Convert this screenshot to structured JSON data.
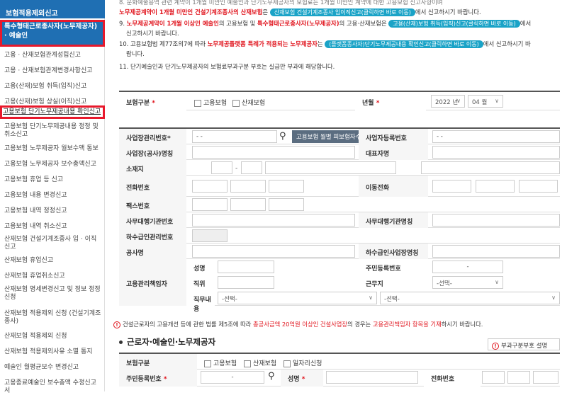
{
  "sidebar": {
    "header": "보험적용제외신고",
    "active": "특수형태근로종사자(노무제공자) · 예술인",
    "items": [
      "고용 · 산재보험관계성립신고",
      "고용 · 산재보험관계변경사항신고",
      "고용(산재)보험 취득(입직)신고",
      "고용(산재)보험 상실(이직)신고",
      "고용보험 단기노무제공내용 확인신고",
      "고용보험 단기노무제공내용 정정 및 취소신고",
      "고용보험 노무제공자 월보수액 통보",
      "고용보험 노무제공자 보수총액신고",
      "고용보험 휴업 등 신고",
      "고용보험 내용 변경신고",
      "고용보험 내역 정정신고",
      "고용보험 내역 취소신고",
      "산재보험 건설기계조종사 입 · 이직신고",
      "산재보험 휴업신고",
      "산재보험 휴업취소신고",
      "산재보험 명세변경신고 및 정보 정정신청",
      "산재보험 적용제외 신청 (건설기계조종사)",
      "산재보험 적용제외 신청",
      "산재보험 적용제외사유 소멸 통지",
      "예술인 월평균보수 변경신고",
      "고용종료예술인 보수총액 수정신고서"
    ]
  },
  "notes": {
    "n8a": "8. 노무제공계약이 1개월 미만인 ",
    "n8_top": "8. 문화예술용역 관련 계약이 1개월 미만인 예술인과 단기노무제공자의 보험료는 1개월 미만인 계약에 대한 고용보험 신고사항이며",
    "n8b_red": "노무제공계약이 1개월 미만인 건설기계조종사의 산재보험",
    "n8b_mid": "은",
    "n8_pill": "산재보험 건설기계조종사 입이직신고(클릭하면 바로 이동)",
    "n8_tail": "에서 신고하시기 바랍니다.",
    "n9_pre": "9. ",
    "n9_red": "노무제공계약이 1개월 이상인 예술인",
    "n9_mid": "의 고용보험 및 ",
    "n9_red2": "특수형태근로종사자(노무제공자)",
    "n9_mid2": "의 고용·산재보험은",
    "n9_pill": "고용(산재)보험 취득(입직)신고(클릭하면 바로 이동)",
    "n9_tail": "에서",
    "n9_line2": "신고하시기 바랍니다.",
    "n10_pre": "10. 고용보험법 제77조의7에 따라 ",
    "n10_red": "노무제공플랫폼 특례가 적용되는 노무제공자",
    "n10_mid": "는",
    "n10_pill": "(플랫폼종사자)단기노무제공내용 확인신고(클릭하면 바로 이동)",
    "n10_tail": "에서 신고하시기 바",
    "n10_line2": "랍니다.",
    "n11": "11. 단기예술인과 단기노무제공자의 보험료부과구분 부호는 실급만 부과에 해당합니다."
  },
  "form": {
    "insurance_type_label": "보험구분",
    "req": "*",
    "emp_ins": "고용보험",
    "ind_ins": "산재보험",
    "ym_label": "년월",
    "year": "2022 년",
    "month": "04 월",
    "mgmt_no_label": "사업장관리번호*",
    "mgmt_no_value": "- -",
    "by_month_btn": "고용보험 월별 피보험자수",
    "biz_reg_label": "사업자등록번호",
    "biz_reg_value": "- -",
    "site_name_label": "사업장(공사)명칭",
    "rep_label": "대표자명",
    "addr_label": "소재지",
    "addr_dash": "-",
    "phone_label": "전화번호",
    "mobile_label": "이동전화",
    "fax_label": "팩스번호",
    "agency_no_label": "사무대행기관번호",
    "agency_name_label": "사무대행기관명칭",
    "sub_no_label": "하수급인관리번호",
    "project_label": "공사명",
    "sub_reg_label": "하수급인사업장명칭",
    "manager_label": "고용관리책임자",
    "name_label": "성명",
    "rrn_label": "주민등록번호",
    "rrn_dash": "-",
    "position_label": "직위",
    "workplace_label": "근무지",
    "select_placeholder": "-선택-",
    "duty_label": "직무내용",
    "duty_select1": "-선택-",
    "duty_select2": "-선택-",
    "warn_pre": "건설근로자의 고용개선 등에 관한 법률 제5조에 따라 ",
    "warn_red1": "총공사금액 20억원 이상인 건설사업장",
    "warn_mid": "의 경우는 ",
    "warn_red2": "고용관리책임자 항목을 기재",
    "warn_tail": "하시기 바랍니다."
  },
  "section2": {
    "title": "근로자·예술인·노무제공자",
    "help": "부과구분부호 설명",
    "ins_label": "보험구분",
    "emp_ins": "고용보험",
    "ind_ins": "산재보험",
    "daily": "일자리신청",
    "rrn_label": "주민등록번호",
    "req": "*",
    "rrn_dash": "-",
    "name_label": "성명",
    "phone_label": "전화번호"
  }
}
